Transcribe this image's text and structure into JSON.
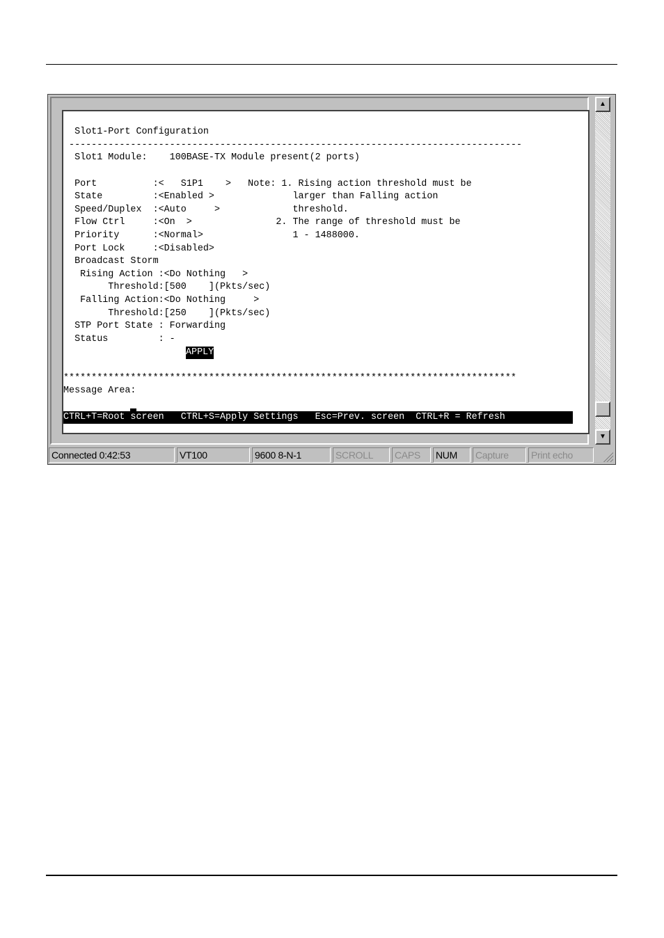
{
  "terminal": {
    "title_line": "  Slot1-Port Configuration",
    "divider_dash": " ---------------------------------------------------------------------------------",
    "module_line": "  Slot1 Module:    100BASE-TX Module present(2 ports)",
    "lines": [
      "  Port          :<   S1P1    >   Note: 1. Rising action threshold must be",
      "  State         :<Enabled >              larger than Falling action",
      "  Speed/Duplex  :<Auto     >             threshold.",
      "  Flow Ctrl     :<On  >               2. The range of threshold must be",
      "  Priority      :<Normal>                1 - 1488000.",
      "  Port Lock     :<Disabled>",
      "  Broadcast Storm",
      "   Rising Action :<Do Nothing   >",
      "        Threshold:[500    ](Pkts/sec)",
      "   Falling Action:<Do Nothing     >",
      "        Threshold:[250    ](Pkts/sec)",
      "  STP Port State : Forwarding",
      "  Status         : -"
    ],
    "apply_label": "APPLY",
    "divider_star": "*********************************************************************************",
    "message_area_label": "Message Area:",
    "help_bar": "CTRL+T=Root screen   CTRL+S=Apply Settings   Esc=Prev. screen  CTRL+R = Refresh"
  },
  "statusbar": {
    "connected": "Connected 0:42:53",
    "emulation": "VT100",
    "port_settings": "9600 8-N-1",
    "scroll": "SCROLL",
    "caps": "CAPS",
    "num": "NUM",
    "capture": "Capture",
    "print_echo": "Print echo"
  },
  "icons": {
    "scroll_up": "scroll-up-arrow-icon",
    "scroll_down": "scroll-down-arrow-icon",
    "resize_grip": "resize-grip-icon"
  }
}
